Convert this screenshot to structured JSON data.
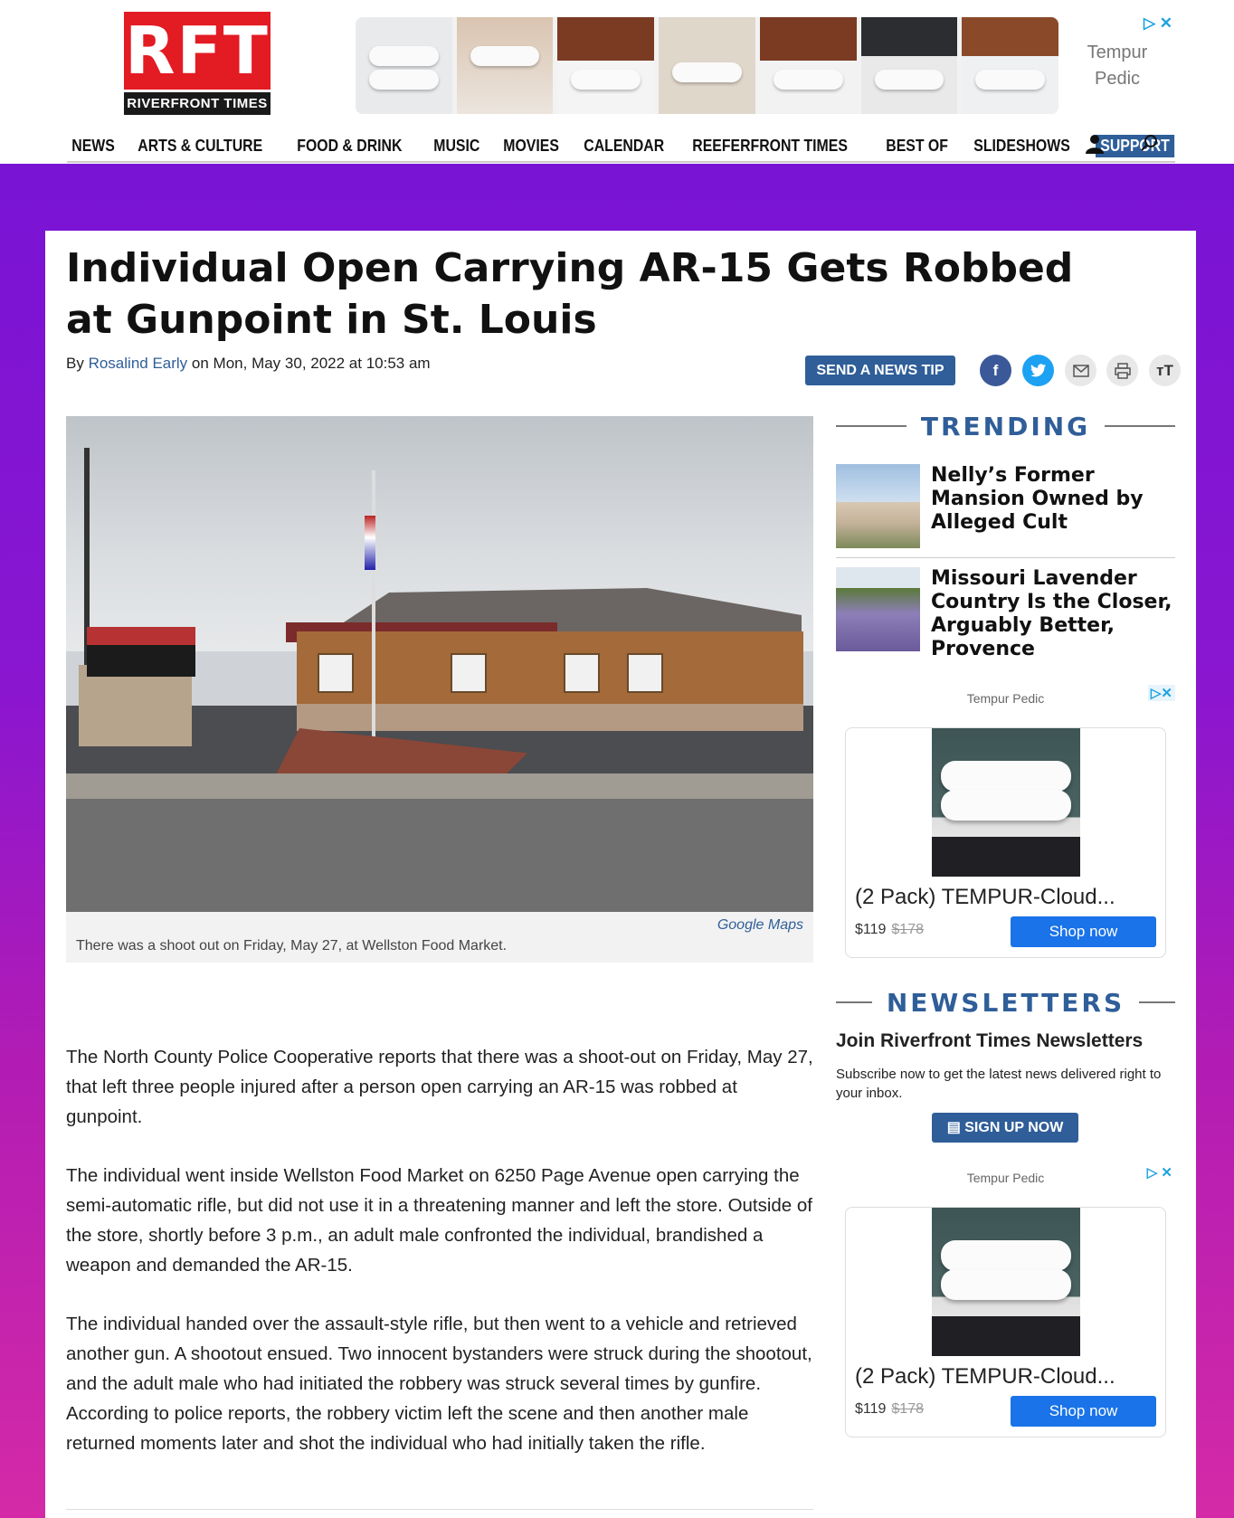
{
  "header": {
    "logo_letters": "RFT",
    "logo_name": "RIVERFRONT TIMES",
    "top_ad": {
      "brand": "Tempur Pedic",
      "choice_icon": "ad-choices-icon"
    },
    "nav": [
      "NEWS",
      "ARTS & CULTURE",
      "FOOD & DRINK",
      "MUSIC",
      "MOVIES",
      "CALENDAR",
      "REEFERFRONT TIMES",
      "BEST OF",
      "SLIDESHOWS"
    ],
    "support": "SUPPORT",
    "icons": [
      "user-icon",
      "search-icon"
    ]
  },
  "colors": {
    "accent": "#2f5e99",
    "background_top": "#7413d6",
    "background_bottom": "#d42aa7",
    "logo_red": "#e31b23"
  },
  "article": {
    "title": "Individual Open Carrying AR-15 Gets Robbed at Gunpoint in St. Louis",
    "byline_prefix": "By",
    "author": "Rosalind Early",
    "date": "on Mon, May 30, 2022 at 10:53 am",
    "tip_button": "SEND A NEWS TIP",
    "share_icons": [
      "facebook-icon",
      "twitter-icon",
      "email-icon",
      "print-icon",
      "text-size-icon"
    ],
    "image_credit": "Google Maps",
    "image_caption": "There was a shoot out on Friday, May 27, at Wellston Food Market.",
    "paragraphs": [
      "The North County Police Cooperative reports that there was a shoot-out on Friday, May 27, that left three people injured after a person open carrying an AR-15 was robbed at gunpoint.",
      "The individual went inside Wellston Food Market on 6250 Page Avenue open carrying the semi-automatic rifle, but did not use it in a threatening manner and left the store. Outside of the store, shortly before 3 p.m., an adult male confronted the individual, brandished a weapon and demanded the AR-15.",
      "The individual handed over the assault-style rifle, but then went to a vehicle and retrieved another gun. A shootout ensued. Two innocent bystanders were struck during the shootout, and the adult male who had initiated the robbery was struck several times by gunfire. According to police reports, the robbery victim left the scene and then another male returned moments later and shot the individual who had initially taken the rifle."
    ]
  },
  "sidebar": {
    "trending_label": "TRENDING",
    "trending": [
      {
        "title": "Nelly’s Former Mansion Owned by Alleged Cult"
      },
      {
        "title": "Missouri Lavender Country Is the Closer, Arguably Better, Provence"
      }
    ],
    "ads": [
      {
        "brand": "Tempur Pedic",
        "product": "(2 Pack) TEMPUR-Cloud...",
        "price": "$119",
        "old_price": "$178",
        "cta": "Shop now"
      },
      {
        "brand": "Tempur Pedic",
        "product": "(2 Pack) TEMPUR-Cloud...",
        "price": "$119",
        "old_price": "$178",
        "cta": "Shop now"
      }
    ],
    "newsletters_label": "NEWSLETTERS",
    "newsletter_title": "Join Riverfront Times Newsletters",
    "newsletter_sub": "Subscribe now to get the latest news delivered right to your inbox.",
    "signup": "SIGN UP NOW"
  }
}
